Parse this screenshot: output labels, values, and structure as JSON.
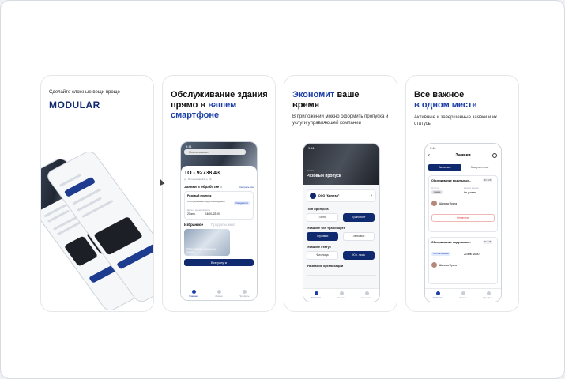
{
  "card1": {
    "tagline": "Сделайте сложные вещи проще",
    "brand": "MODULAR"
  },
  "card2": {
    "title_line1": "Обслуживание здания",
    "title_line2a": "прямо в",
    "title_line2b": "вашем",
    "title_line3": "смартфоне",
    "phone": {
      "time": "9:41",
      "search_placeholder": "Поиск заявки",
      "object_code": "ТО - 92738 43",
      "address": "ул. Мельникова 24, д. 16",
      "section": "Заявки в обработке",
      "section_count": "3",
      "see_all": "Смотреть все",
      "request_title": "Разовый пропуск",
      "request_desc": "Обслуживание модульных зданий",
      "request_status": "Ожидается",
      "request_label": "Дата и время визита",
      "request_date": "23 янв.",
      "request_time": "16:00–22:00",
      "tab_favorites": "Избранное",
      "tab_products": "Продукты мыл",
      "fav_caption": "Обслуживание модульных зданий",
      "all_services": "Все услуги",
      "nav": [
        "Главная",
        "Заявки",
        "Профиль"
      ]
    }
  },
  "card3": {
    "title_accent": "Экономит",
    "title_rest": "ваше",
    "title_line2": "время",
    "subtitle": "В приложении можно оформить пропуска и услуги управляющей компании",
    "phone": {
      "time": "9:41",
      "hero_small": "Услуга",
      "hero_title": "Разовый пропуск",
      "company": "ООО \"Крестал\"",
      "pass_type_label": "Тип пропуска",
      "pass_types": [
        "Гость",
        "Транспорт"
      ],
      "transport_label": "Укажите тип транспорта",
      "transport_types": [
        "Грузовой",
        "Легковой"
      ],
      "status_label": "Укажите статус",
      "status_types": [
        "Физ.лица",
        "Юр. лица"
      ],
      "org_label": "Название организации",
      "nav": [
        "Главная",
        "Заявки",
        "Профиль"
      ]
    }
  },
  "card4": {
    "title_line1": "Все важное",
    "title_line2": "в одном месте",
    "subtitle": "Активные и завершенные заявки и их статусы",
    "phone": {
      "time": "9:41",
      "header": "Заявки",
      "tabs": [
        "Активные",
        "Завершенные"
      ],
      "item1_title": "Обслуживание модульных...",
      "item1_badge": "ID 126",
      "item1_status_label": "Статус",
      "item1_status": "Новая",
      "item1_date_label": "Дата и время",
      "item1_date": "Не указан",
      "item1_person": "Шилова Ирина",
      "item1_cancel": "Отменить",
      "item2_title": "Обслуживание модульных...",
      "item2_badge": "ID 128",
      "item2_status": "Согласование",
      "item2_date": "23 янв. 16:00",
      "item2_person": "Шилова Ирина",
      "nav": [
        "Главная",
        "Заявки",
        "Профиль"
      ]
    }
  },
  "colors": {
    "brand_navy": "#0f2a6e",
    "accent_blue": "#1b3fa6",
    "frame": "#d7dbe2"
  }
}
